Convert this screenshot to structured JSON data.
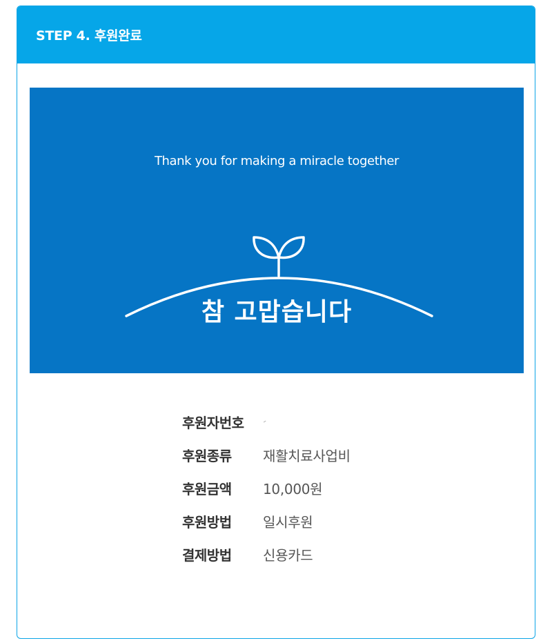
{
  "header": {
    "title": "STEP 4. 후원완료"
  },
  "banner": {
    "tagline": "Thank you for making a miracle together",
    "headline": "참 고맙습니다",
    "bg_color": "#0675c5",
    "icon": "sprout-icon"
  },
  "details": {
    "rows": [
      {
        "label": "후원자번호",
        "value": "-"
      },
      {
        "label": "후원종류",
        "value": "재활치료사업비"
      },
      {
        "label": "후원금액",
        "value": "10,000원"
      },
      {
        "label": "후원방법",
        "value": "일시후원"
      },
      {
        "label": "결제방법",
        "value": "신용카드"
      }
    ]
  },
  "colors": {
    "header_bg": "#06a6e8",
    "card_border": "#0aa4e6",
    "label_text": "#333333",
    "value_text": "#555555"
  }
}
